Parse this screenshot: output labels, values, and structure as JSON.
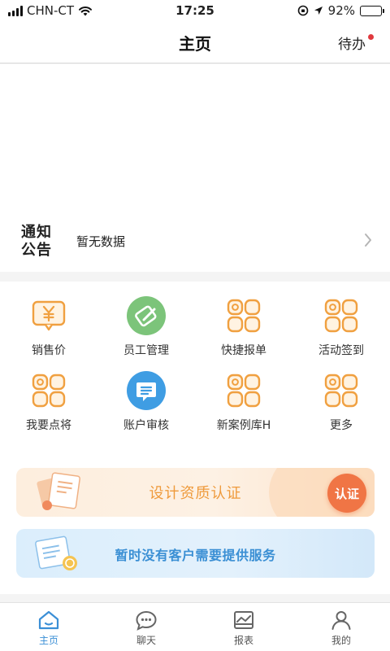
{
  "status_bar": {
    "carrier": "CHN-CT",
    "time": "17:25",
    "battery": "92%",
    "battery_level": 0.92
  },
  "header": {
    "title": "主页",
    "todo_label": "待办"
  },
  "notice": {
    "label": "通知公告",
    "text": "暂无数据"
  },
  "grid": {
    "items": [
      {
        "label": "销售价",
        "icon": "yen-tag-icon"
      },
      {
        "label": "员工管理",
        "icon": "employee-manage-icon"
      },
      {
        "label": "快捷报单",
        "icon": "grid-apps-icon"
      },
      {
        "label": "活动签到",
        "icon": "grid-apps-icon"
      },
      {
        "label": "我要点将",
        "icon": "grid-apps-icon"
      },
      {
        "label": "账户审核",
        "icon": "account-review-icon"
      },
      {
        "label": "新案例库H",
        "icon": "grid-apps-icon"
      },
      {
        "label": "更多",
        "icon": "grid-apps-icon"
      }
    ]
  },
  "cert_banner": {
    "text": "设计资质认证",
    "button": "认证"
  },
  "service_banner": {
    "text": "暂时没有客户需要提供服务"
  },
  "tabbar": {
    "tabs": [
      {
        "label": "主页"
      },
      {
        "label": "聊天"
      },
      {
        "label": "报表"
      },
      {
        "label": "我的"
      }
    ],
    "active": "主页"
  },
  "colors": {
    "accent_blue": "#3b8fd6",
    "orange": "#f0a040",
    "cert_orange": "#f07545",
    "green": "#7cc47a",
    "red_dot": "#e0393e"
  }
}
